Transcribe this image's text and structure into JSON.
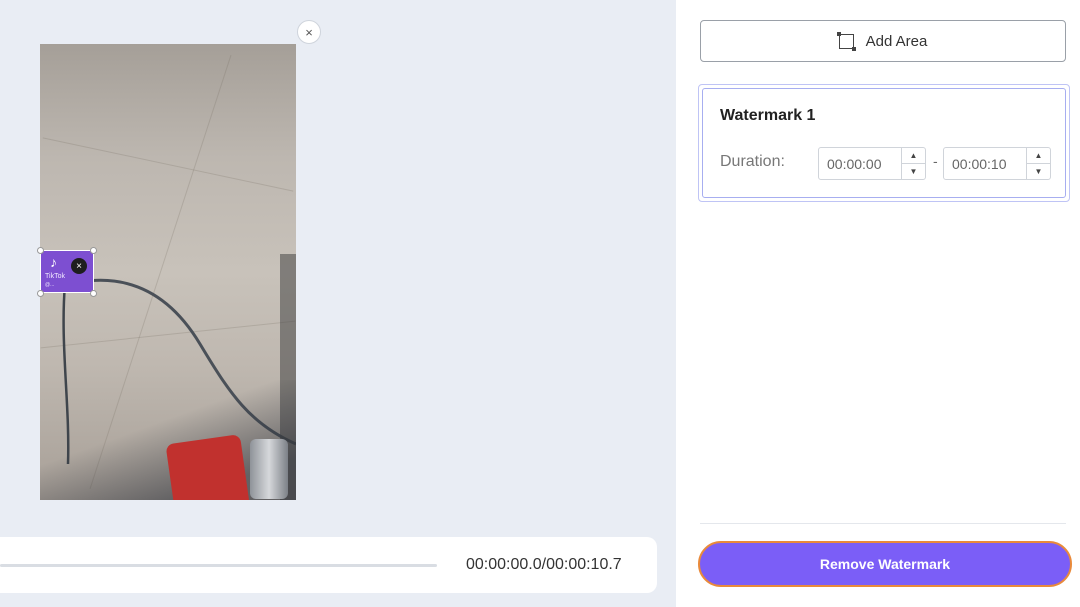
{
  "video": {
    "close_icon": "×",
    "watermark_overlay": {
      "note_icon": "♪",
      "brand_text": "TikTok",
      "username_text": "@...",
      "close_icon": "×"
    }
  },
  "player": {
    "time_display": "00:00:00.0/00:00:10.7",
    "progress": 0
  },
  "panel": {
    "add_area_label": "Add Area",
    "watermark_card": {
      "title": "Watermark 1",
      "duration_label": "Duration:",
      "start_time": "00:00:00",
      "end_time": "00:00:10",
      "separator": "-",
      "up_arrow": "▲",
      "down_arrow": "▼"
    },
    "remove_button_label": "Remove Watermark"
  },
  "colors": {
    "accent": "#7b5ef7",
    "highlight_ring": "#e98a3b",
    "watermark_box": "#7d4fd1"
  }
}
